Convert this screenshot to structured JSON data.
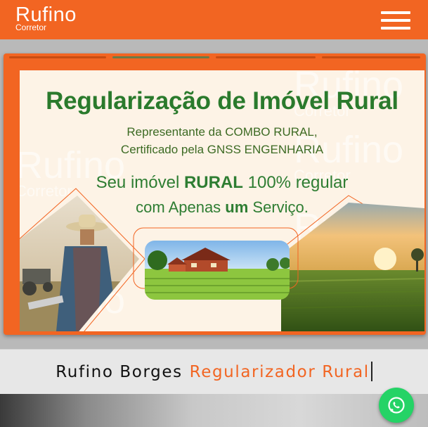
{
  "header": {
    "logo_main": "Rufino",
    "logo_sub": "Corretor",
    "menu_icon": "hamburger-menu-icon",
    "brand_color": "#f26522"
  },
  "carousel": {
    "slide_count": 4,
    "active_index": 1,
    "slide": {
      "title": "Regularização de Imóvel Rural",
      "subtitle_line1": "Representante da COMBO RURAL,",
      "subtitle_line2": "Certificado pela GNSS ENGENHARIA",
      "headline_line1_prefix": "Seu imóvel ",
      "headline_line1_bold": "RURAL",
      "headline_line1_suffix": " 100% regular",
      "headline_line2_prefix": "com Apenas ",
      "headline_line2_bold": "um",
      "headline_line2_suffix": " Serviço.",
      "watermark_main": "Rufino",
      "watermark_sub": "Corretor",
      "title_color": "#2a7a2c"
    }
  },
  "profile": {
    "name": "Rufino Borges",
    "role": "Regularizador Rural"
  },
  "floating": {
    "whatsapp_icon": "whatsapp-icon",
    "whatsapp_color": "#25d366"
  }
}
